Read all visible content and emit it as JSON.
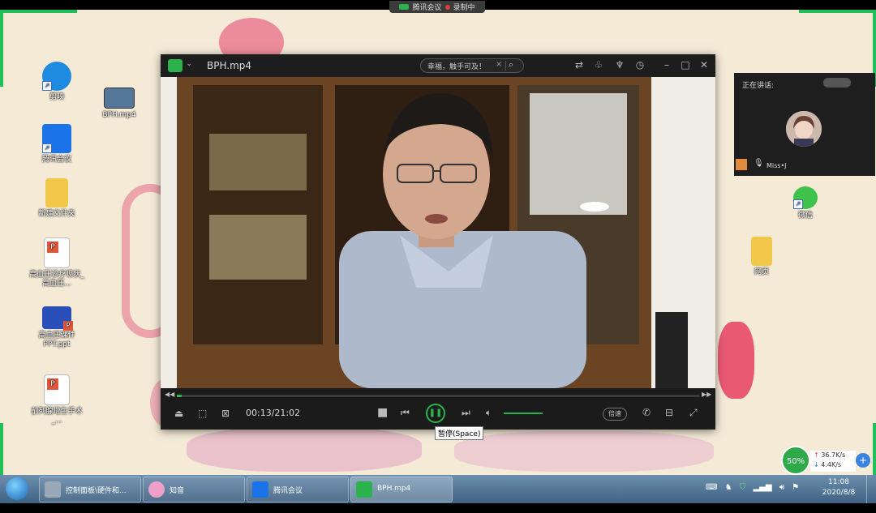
{
  "recording_bar": {
    "meeting_label": "腾讯会议",
    "recording_label": "录制中"
  },
  "desktop_icons": [
    {
      "label": "剪映",
      "icon": "jianying-icon",
      "color": "#1e8ae0"
    },
    {
      "label": "BPH.mp4",
      "icon": "video-thumbnail-icon",
      "color": "#557799"
    },
    {
      "label": "腾讯会议",
      "icon": "tencent-meeting-icon",
      "color": "#1a73e8"
    },
    {
      "label": "新建文件夹",
      "icon": "folder-icon",
      "color": "#f2c84b"
    },
    {
      "label": "高血压诊疗现状_高血压...",
      "icon": "pptx-file-icon",
      "color": "#e0563a"
    },
    {
      "label": "高血压课件PPT.ppt",
      "icon": "ppt-file-icon",
      "color": "#2b4fb8"
    },
    {
      "label": "前列腺增生手术_...",
      "icon": "pptx-file-icon",
      "color": "#e0563a"
    },
    {
      "label": "微信",
      "icon": "wechat-icon",
      "color": "#3ec24a"
    },
    {
      "label": "网页",
      "icon": "folder-icon",
      "color": "#f2c84b"
    }
  ],
  "player": {
    "filename": "BPH.mp4",
    "search_value": "幸福，触手可及！",
    "time": "00:13/21:02",
    "progress": 0.01,
    "volume": 1.0,
    "speed_label": "倍速",
    "tooltip": "暂停(Space)"
  },
  "speaker_panel": {
    "title": "正在讲话:",
    "name": "Miss•J"
  },
  "taskbar": {
    "items": [
      {
        "label": "控制面板\\硬件和...",
        "icon": "control-panel-icon",
        "color": "#9aa8b8"
      },
      {
        "label": "知音",
        "icon": "zhiyin-icon",
        "color": "#f0a0c8"
      },
      {
        "label": "腾讯会议",
        "icon": "tencent-meeting-icon",
        "color": "#1a73e8"
      },
      {
        "label": "BPH.mp4",
        "icon": "video-player-icon",
        "color": "#2bb24c"
      }
    ],
    "time": "11:08",
    "date": "2020/8/8"
  },
  "net_widget": {
    "percent": "50%",
    "upload": "36.7K/s",
    "download": "4.4K/s"
  }
}
